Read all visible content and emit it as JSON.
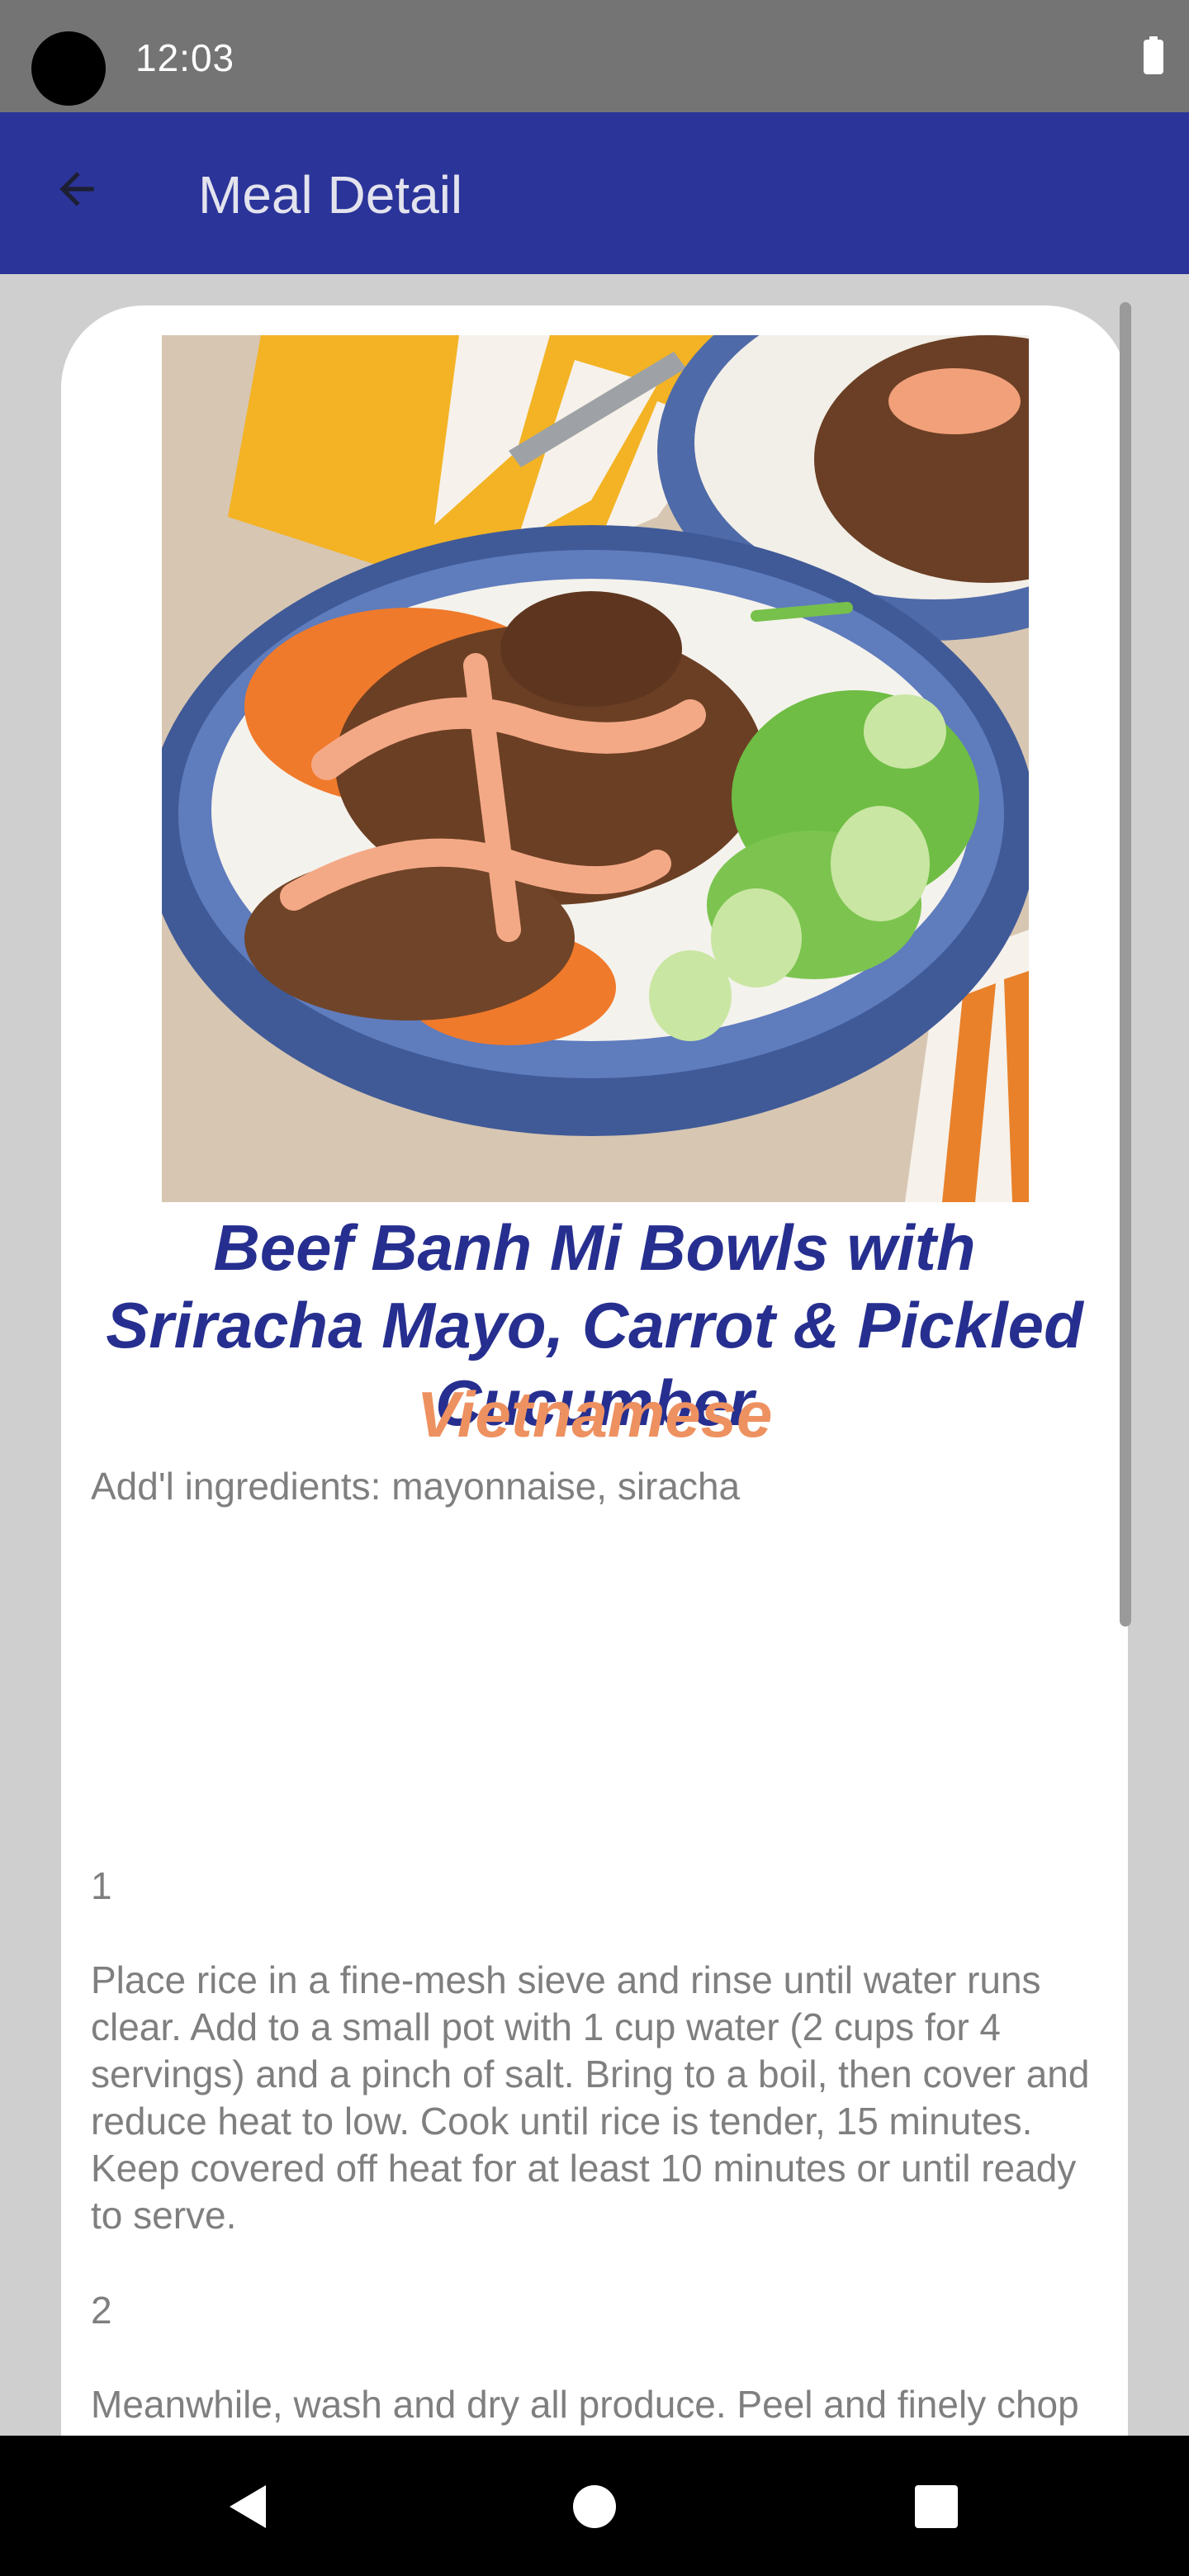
{
  "status_bar": {
    "time": "12:03"
  },
  "app_bar": {
    "title": "Meal Detail"
  },
  "meal": {
    "title": "Beef Banh Mi Bowls with Sriracha Mayo, Carrot & Pickled Cucumber",
    "area": "Vietnamese",
    "additional_ingredients": "Add'l ingredients: mayonnaise, siracha",
    "steps": [
      {
        "number": "1",
        "text": "Place rice in a fine-mesh sieve and rinse until water runs clear. Add to a small pot with 1 cup water (2 cups for 4 servings) and a pinch of salt. Bring to a boil, then cover and reduce heat to low. Cook until rice is tender, 15 minutes. Keep covered off heat for at least 10 minutes or until ready to serve."
      },
      {
        "number": "2",
        "text": "Meanwhile, wash and dry all produce. Peel and finely chop garlic. Zest and quarter lime (for 4 servings, zest 1 lime and quarter both). Trim and halve cucumber lengthwise; thinly slice crosswise into half-moons. Halve, peel, and medium dice onion. Trim, peel, and grate carrot."
      }
    ]
  },
  "icons": {
    "back": "arrow-back-icon",
    "battery": "battery-icon",
    "nav_back": "triangle-back-icon",
    "nav_home": "circle-home-icon",
    "nav_recents": "square-recents-icon"
  },
  "colors": {
    "app_bar": "#2b3499",
    "title": "#262f8f",
    "area": "#ee9160",
    "body_text": "#7f7f7f"
  }
}
